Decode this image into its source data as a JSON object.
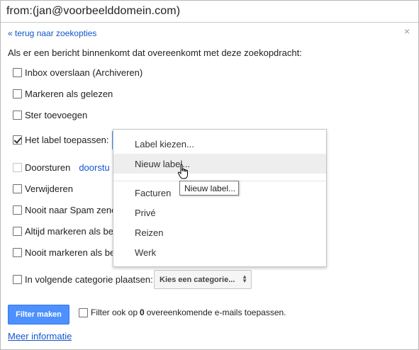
{
  "query": {
    "text": "from:(jan@voorbeelddomein.com)"
  },
  "back_link": "« terug naar zoekopties",
  "close_icon": "×",
  "intro": "Als er een bericht binnenkomt dat overeenkomt met deze zoekopdracht:",
  "options": {
    "skip_inbox": {
      "label": "Inbox overslaan (Archiveren)",
      "checked": false
    },
    "mark_read": {
      "label": "Markeren als gelezen",
      "checked": false
    },
    "star": {
      "label": "Ster toevoegen",
      "checked": false
    },
    "apply_label": {
      "label": "Het label toepassen:",
      "checked": true
    },
    "forward": {
      "label": "Doorsturen",
      "link": "doorstu",
      "checked": false,
      "disabled": true
    },
    "delete": {
      "label": "Verwijderen",
      "checked": false
    },
    "never_spam": {
      "label": "Nooit naar Spam zenc",
      "checked": false
    },
    "always_important": {
      "label": "Altijd markeren als be",
      "checked": false
    },
    "never_important": {
      "label": "Nooit markeren als be",
      "checked": false
    },
    "category": {
      "label": "In volgende categorie plaatsen:",
      "checked": false,
      "select_value": "Kies een categorie..."
    }
  },
  "filter_button": "Filter maken",
  "apply_existing": {
    "prefix": "Filter ook op",
    "count": "0",
    "suffix": "overeenkomende e-mails toepassen.",
    "checked": false
  },
  "more_info": "Meer informatie",
  "label_menu": {
    "choose": "Label kiezen...",
    "new_label": "Nieuw label...",
    "labels": [
      "Facturen",
      "Privé",
      "Reizen",
      "Werk"
    ]
  },
  "tooltip": "Nieuw label...",
  "colors": {
    "link": "#1155cc",
    "primary_button": "#4d90fe",
    "focus": "#4d90fe"
  }
}
